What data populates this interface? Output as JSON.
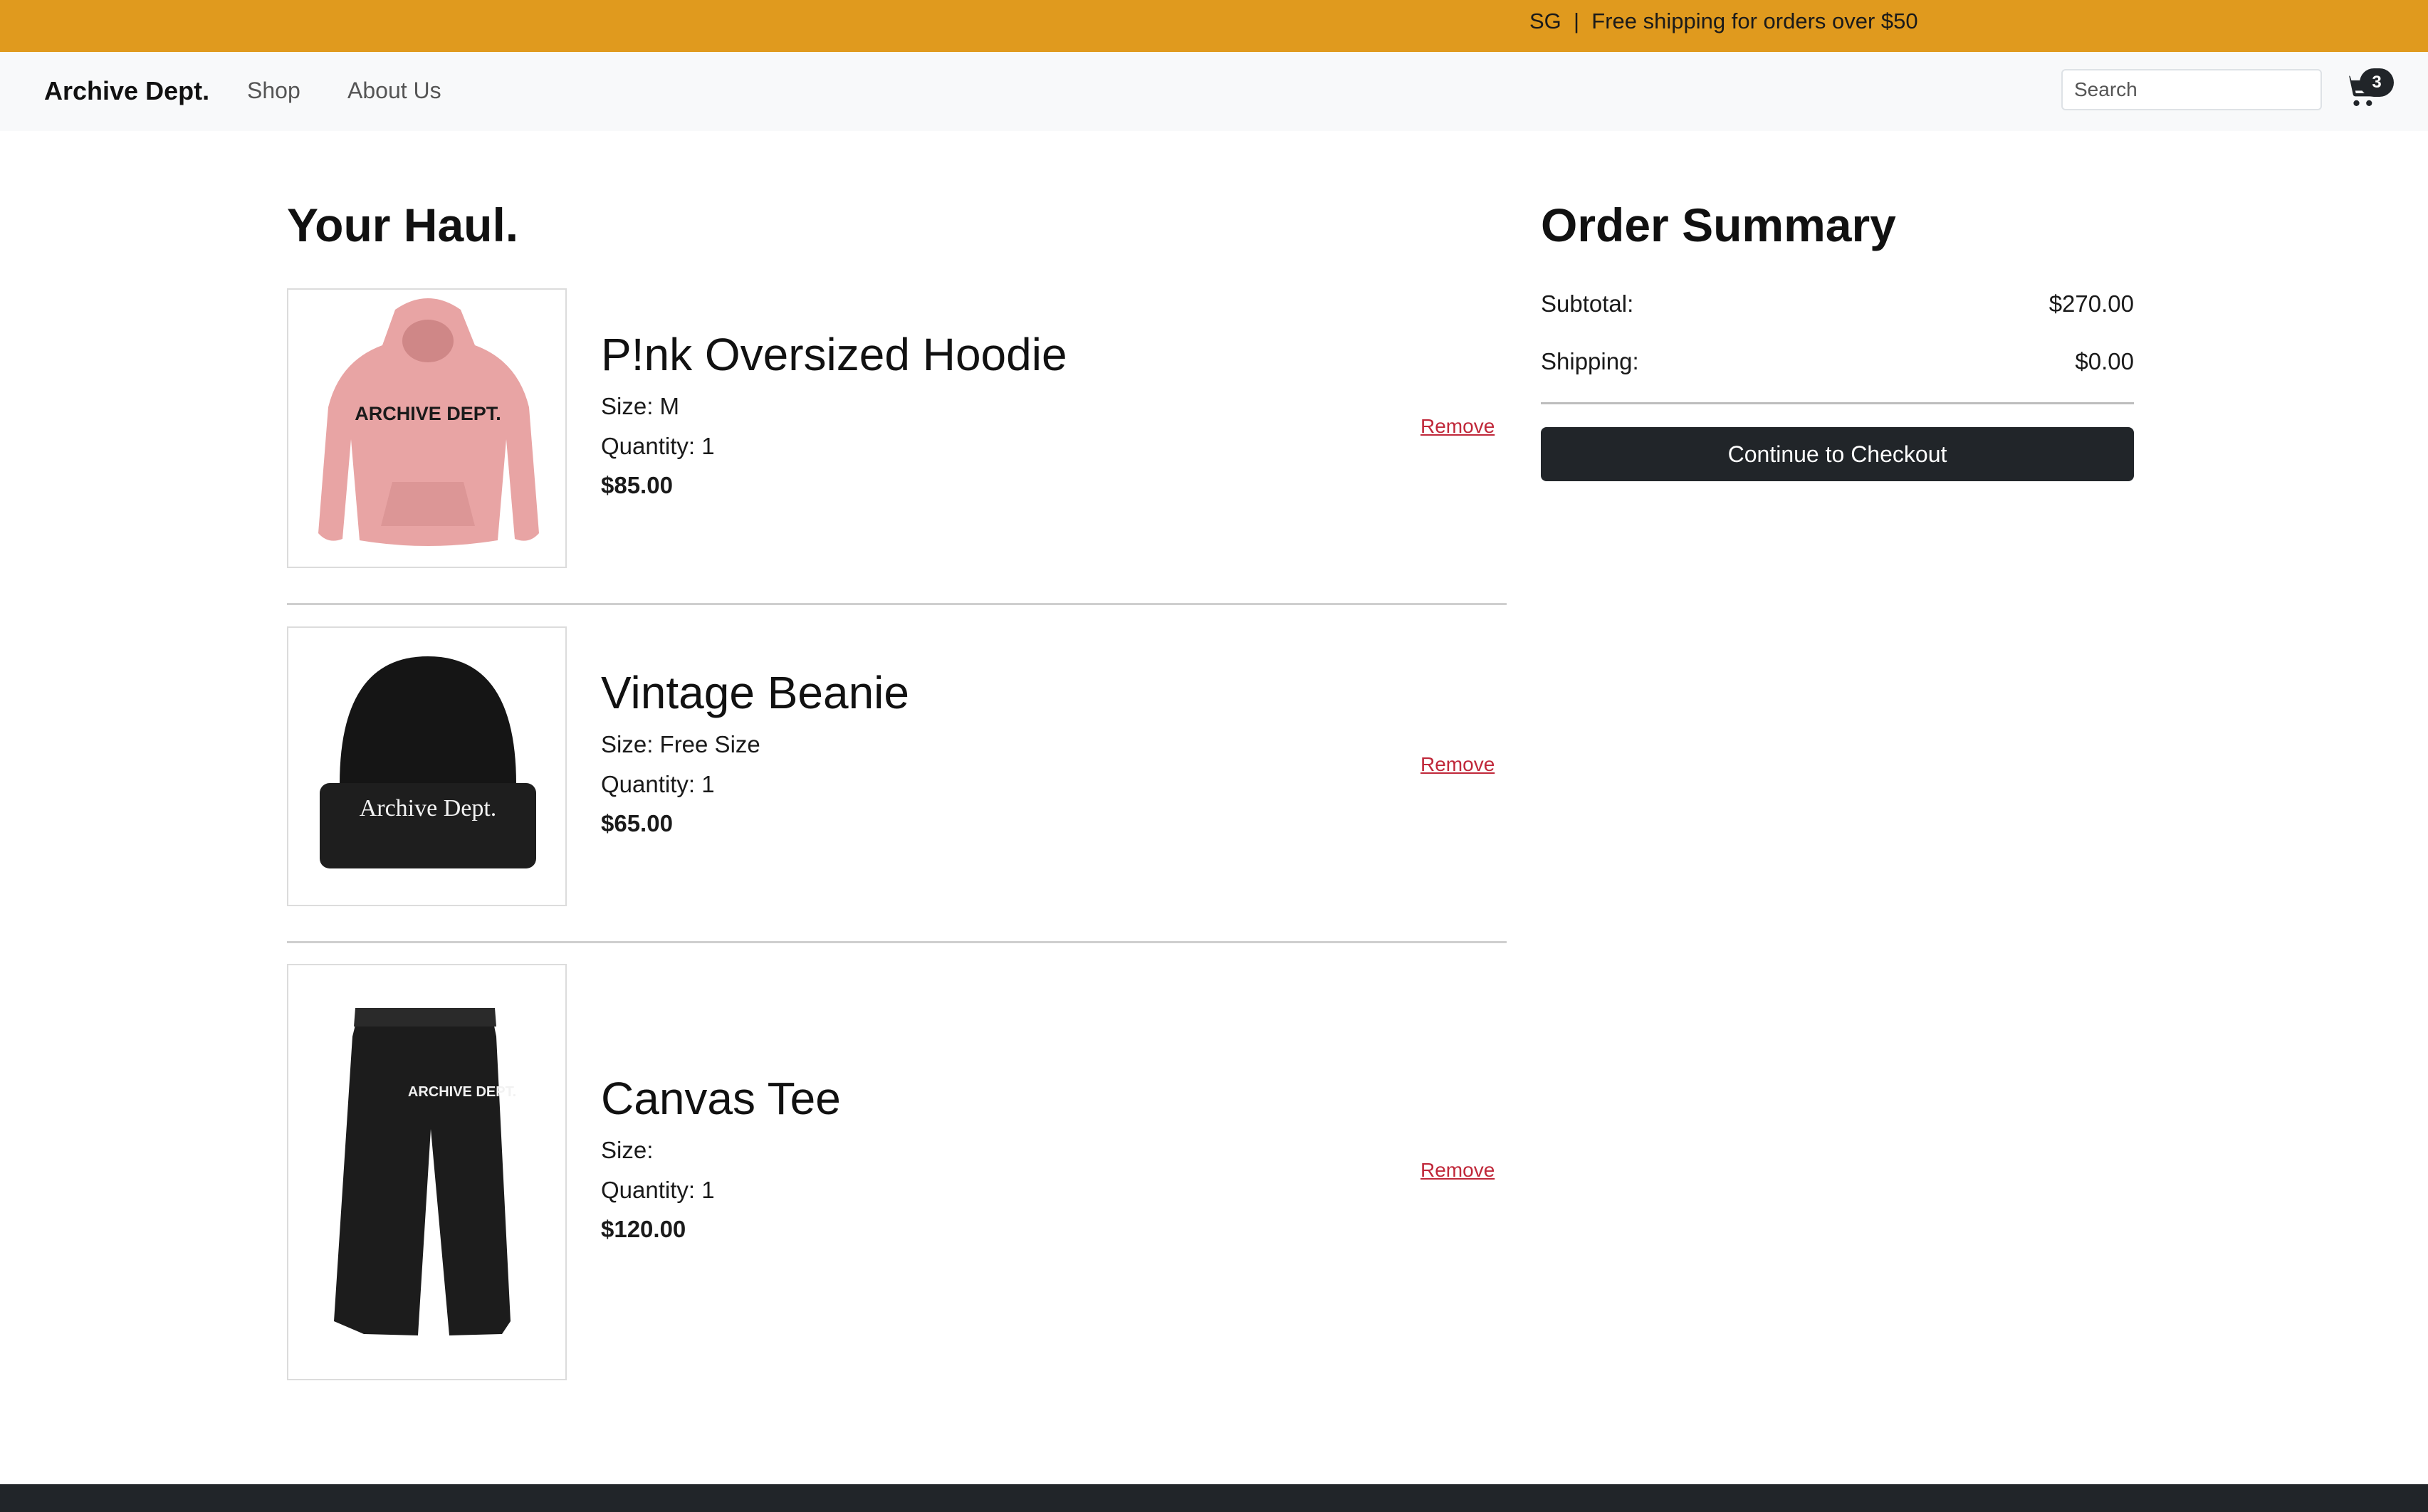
{
  "promo": {
    "text": "SG  |  Free shipping for orders over $50"
  },
  "nav": {
    "brand": "Archive Dept.",
    "links": [
      "Shop",
      "About Us"
    ],
    "search_placeholder": "Search",
    "cart_count": "3",
    "cart_icon": "cart-icon"
  },
  "cart": {
    "title": "Your Haul.",
    "items": [
      {
        "name": "P!nk Oversized Hoodie",
        "size": "Size: M",
        "quantity": "Quantity: 1",
        "price": "$85.00",
        "remove_label": "Remove",
        "image_label": "ARCHIVE DEPT.",
        "image_color": "#E8A4A4"
      },
      {
        "name": "Vintage Beanie",
        "size": "Size: Free Size",
        "quantity": "Quantity: 1",
        "price": "$65.00",
        "remove_label": "Remove",
        "image_label": "Archive Dept.",
        "image_color": "#151515"
      },
      {
        "name": "Canvas Tee",
        "size": "Size:",
        "quantity": "Quantity: 1",
        "price": "$120.00",
        "remove_label": "Remove",
        "image_label": "ARCHIVE DEPT.",
        "image_color": "#1c1c1c"
      }
    ]
  },
  "summary": {
    "title": "Order Summary",
    "subtotal_label": "Subtotal:",
    "subtotal_value": "$270.00",
    "shipping_label": "Shipping:",
    "shipping_value": "$0.00",
    "checkout_label": "Continue to Checkout"
  },
  "colors": {
    "promo_bar": "#E09A1E",
    "navbar": "#F8F9FA",
    "button_dark": "#212529",
    "remove_link": "#C0283A"
  }
}
